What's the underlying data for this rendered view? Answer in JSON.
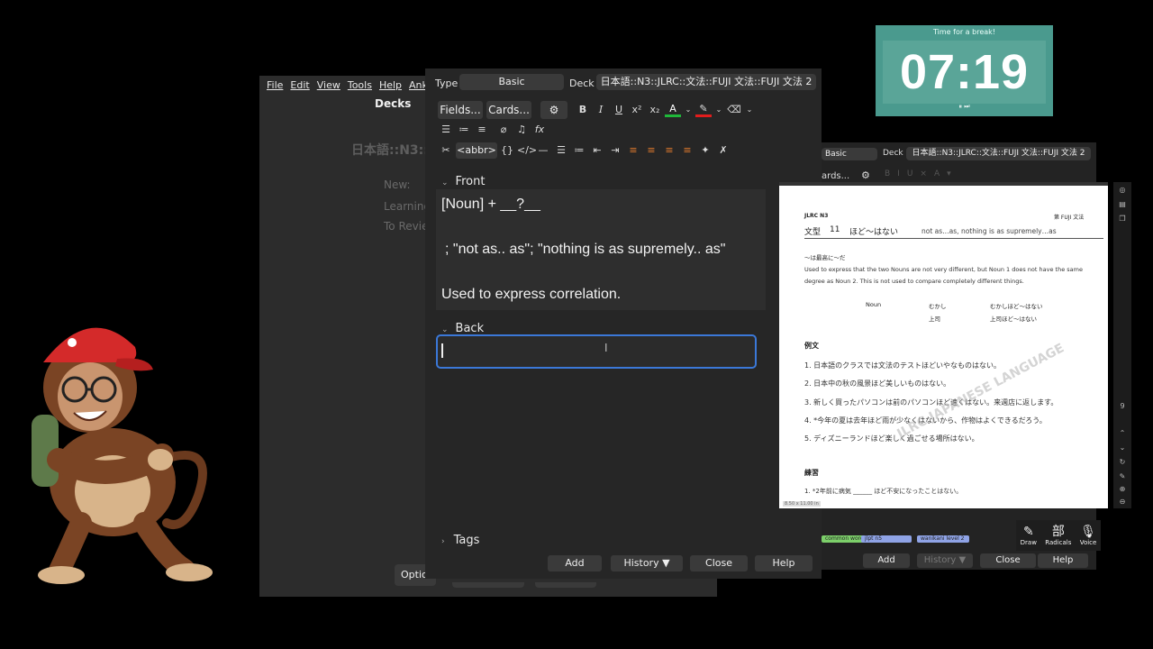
{
  "main_window": {
    "menu": [
      "File",
      "Edit",
      "View",
      "Tools",
      "Help",
      "Anki"
    ],
    "title": "Decks",
    "deck_name": "日本語::N3::",
    "stats": [
      "New:",
      "Learning",
      "To Revie"
    ],
    "options_button": "Optio"
  },
  "editor": {
    "type_label": "Type",
    "type_value": "Basic",
    "deck_label": "Deck",
    "deck_value": "日本語::N3::JLRC::文法::FUJI 文法::FUJI 文法 2",
    "fields_button": "Fields...",
    "cards_button": "Cards...",
    "abbr_button": "<abbr>",
    "front_label": "Front",
    "front_lines": [
      "[Noun] + __?__",
      "; \"not as.. as\"; \"nothing is as supremely.. as\"",
      "Used to express correlation."
    ],
    "back_label": "Back",
    "back_value": "",
    "tags_label": "Tags",
    "buttons": {
      "add": "Add",
      "history": "History ▼",
      "close": "Close",
      "help": "Help"
    }
  },
  "timer": {
    "caption": "Time for a break!",
    "time": "07:19",
    "controls": "⏸ ⏭"
  },
  "second_window": {
    "type_value": "Basic",
    "deck_label": "Deck",
    "deck_value": "日本語::N3::JLRC::文法::FUJI 文法::FUJI 文法 2",
    "cards_button": "ards...",
    "tags": [
      "common word",
      "jlpt n5",
      "wanikani level 2"
    ],
    "buttons": {
      "add": "Add",
      "history": "History ▼",
      "close": "Close",
      "help": "Help"
    },
    "tools": [
      {
        "glyph": "✎",
        "label": "Draw"
      },
      {
        "glyph": "部",
        "label": "Radicals"
      },
      {
        "glyph": "🎙",
        "label": "Voice"
      }
    ]
  },
  "pdf": {
    "header_left": "JLRC N3",
    "header_right": "第 FUJI 文法",
    "pattern_label": "文型",
    "pattern_number": "11",
    "pattern": "ほど〜はない",
    "meaning": "not as…as, nothing is as supremely…as",
    "subtitle": "〜は最高に〜だ",
    "explanation": "Used to express that the two Nouns are not very different, but Noun 1 does not have the same degree as Noun 2. This is not used to compare completely different things.",
    "table": [
      [
        "Noun",
        "むかし",
        "むかしほど〜はない"
      ],
      [
        "",
        "上司",
        "上司ほど〜はない"
      ]
    ],
    "examples_heading": "例文",
    "examples": [
      "1. 日本語のクラスでは文法のテストほどいやなものはない。",
      "2. 日本中の秋の風景ほど美しいものはない。",
      "3. 新しく買ったパソコンは前のパソコンほど速くはない。来週店に返します。",
      "4. *今年の夏は去年ほど雨が少なくはないから、作物はよくできるだろう。",
      "5. ディズニーランドほど楽しく過ごせる場所はない。"
    ],
    "exercise_heading": "練習",
    "exercise": "1. *2年前に病気 ______ ほど不安になったことはない。",
    "watermark": "JLRC JAPANESE LANGUAGE",
    "footer": "8.50 x 11.00 in"
  }
}
